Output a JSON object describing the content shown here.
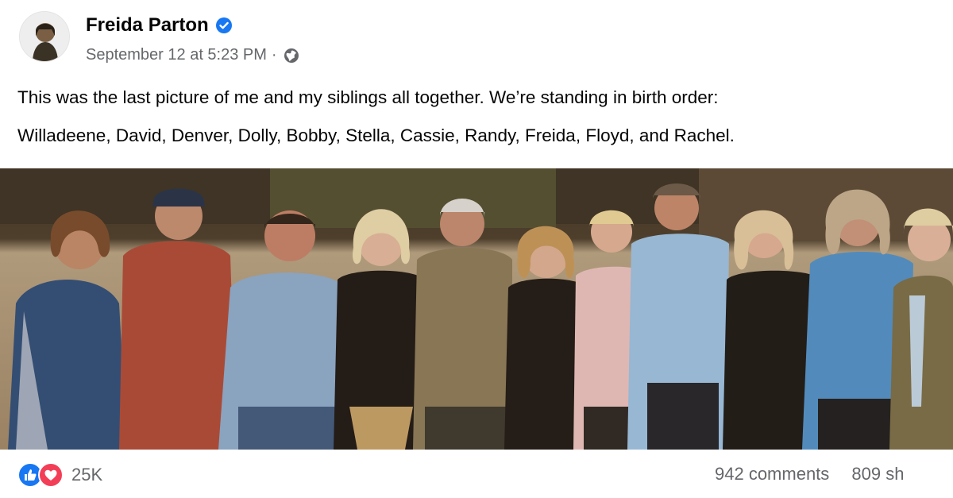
{
  "post": {
    "author": "Freida Parton",
    "timestamp": "September 12 at 5:23 PM",
    "separator": "·",
    "text_line1": "This was the last picture of me and my siblings all together. We’re standing in birth order:",
    "text_line2": "Willadeene, David, Denver, Dolly, Bobby, Stella, Cassie, Randy, Freida, Floyd, and Rachel."
  },
  "icons": {
    "verified": "verified-badge-icon",
    "audience": "globe-icon",
    "like": "like-icon",
    "love": "love-icon"
  },
  "engagement": {
    "reaction_count": "25K",
    "comments": "942 comments",
    "shares": "809 sh"
  },
  "colors": {
    "facebook_blue": "#1877f2",
    "love_red": "#f33e58",
    "meta_gray": "#65676b"
  }
}
